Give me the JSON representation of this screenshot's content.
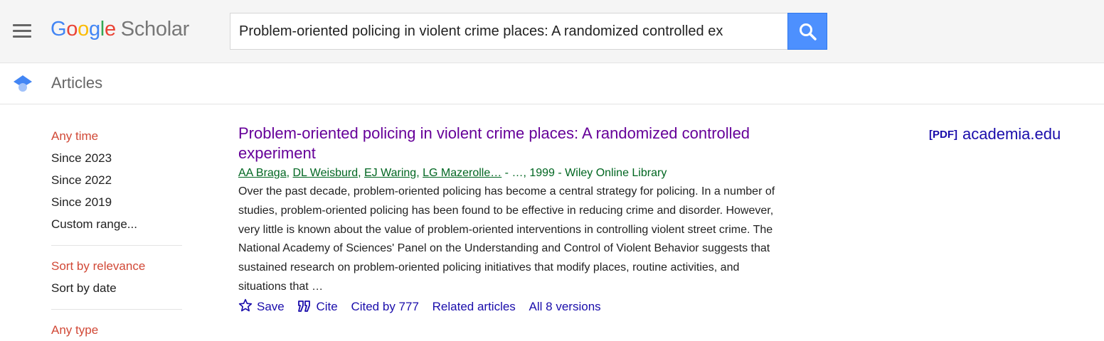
{
  "header": {
    "logo_google": "Google",
    "logo_scholar": "Scholar",
    "search_value": "Problem-oriented policing in violent crime places: A randomized controlled ex"
  },
  "subheader": {
    "title": "Articles"
  },
  "sidebar": {
    "time_filters": [
      "Any time",
      "Since 2023",
      "Since 2022",
      "Since 2019",
      "Custom range..."
    ],
    "sort_options": [
      "Sort by relevance",
      "Sort by date"
    ],
    "type_label": "Any type"
  },
  "result": {
    "title": "Problem-oriented policing in violent crime places: A randomized controlled experiment",
    "authors": [
      "AA Braga",
      "DL Weisburd",
      "EJ Waring",
      "LG Mazerolle…"
    ],
    "source": " - …, 1999 - Wiley Online Library",
    "snippet": "Over the past decade, problem-oriented policing has become a central strategy for policing. In a number of studies, problem-oriented policing has been found to be effective in reducing crime and disorder. However, very little is known about the value of problem-oriented interventions in controlling violent street crime. The National Academy of Sciences' Panel on the Understanding and Control of Violent Behavior suggests that sustained research on problem-oriented policing initiatives that modify places, routine activities, and situations that …",
    "actions": {
      "save": "Save",
      "cite": "Cite",
      "cited_by": "Cited by 777",
      "related": "Related articles",
      "versions": "All 8 versions"
    },
    "pdf_tag": "[PDF]",
    "pdf_source": "academia.edu"
  },
  "colors": {
    "link": "#1a0dab",
    "visited": "#660099",
    "green": "#006621",
    "selected": "#d14836",
    "search_button": "#4d90fe"
  }
}
